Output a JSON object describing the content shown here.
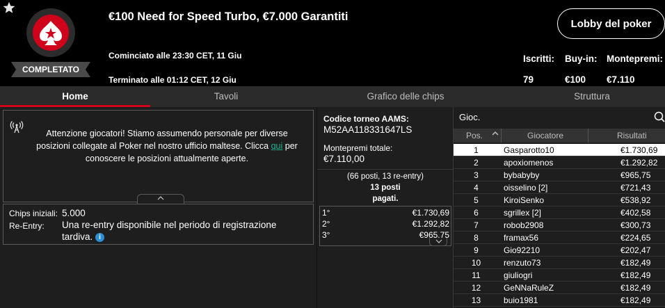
{
  "header": {
    "title": "€100 Need for Speed Turbo, €7.000 Garantiti",
    "started": "Cominciato alle 23:30 CET, 11 Giu",
    "ended": "Terminato alle 01:12 CET, 12 Giu",
    "status": "COMPLETATO",
    "lobby_button": "Lobby del poker",
    "stats": {
      "entrants_label": "Iscritti:",
      "entrants_value": "79",
      "buyin_label": "Buy-in:",
      "buyin_value": "€100",
      "prizepool_label": "Montepremi:",
      "prizepool_value": "€7.110"
    }
  },
  "tabs": [
    {
      "label": "Home",
      "active": true
    },
    {
      "label": "Tavoli",
      "active": false
    },
    {
      "label": "Grafico delle chips",
      "active": false
    },
    {
      "label": "Struttura",
      "active": false
    }
  ],
  "notice": {
    "text_before": "Attenzione giocatori! Stiamo assumendo personale per diverse posizioni collegate al Poker nel nostro ufficio maltese. Clicca ",
    "link": "qui",
    "text_after": " per conoscere le posizioni attualmente aperte."
  },
  "info": {
    "chips_label": "Chips iniziali:",
    "chips_value": "5.000",
    "reentry_label": "Re-Entry:",
    "reentry_value": "Una re-entry disponibile nel periodo di registrazione tardiva."
  },
  "middle": {
    "code_label": "Codice torneo AAMS:",
    "code_value": "M52AA118331647LS",
    "prizepool_label": "Montepremi totale:",
    "prizepool_value": "€7.110,00",
    "seats_line1": "(66 posti, 13 re-entry)",
    "seats_line2": "13 posti",
    "seats_line3": "pagati.",
    "prizes": [
      {
        "pos": "1°",
        "amount": "€1.730,69"
      },
      {
        "pos": "2°",
        "amount": "€1.292,82"
      },
      {
        "pos": "3°",
        "amount": "€965,75"
      }
    ]
  },
  "results": {
    "search_placeholder": "Gioc.",
    "col_pos": "Pos.",
    "col_player": "Giocatore",
    "col_results": "Risultati",
    "rows": [
      {
        "pos": "1",
        "name": "Gasparotto10",
        "result": "€1.730,69"
      },
      {
        "pos": "2",
        "name": "apoxiomenos",
        "result": "€1.292,82"
      },
      {
        "pos": "3",
        "name": "bybabyby",
        "result": "€965,75"
      },
      {
        "pos": "4",
        "name": "oisselino [2]",
        "result": "€721,43"
      },
      {
        "pos": "5",
        "name": "KiroiSenko",
        "result": "€538,92"
      },
      {
        "pos": "6",
        "name": "sgrillex [2]",
        "result": "€402,58"
      },
      {
        "pos": "7",
        "name": "robob2908",
        "result": "€300,73"
      },
      {
        "pos": "8",
        "name": "framax56",
        "result": "€224,65"
      },
      {
        "pos": "9",
        "name": "Gio92210",
        "result": "€202,47"
      },
      {
        "pos": "10",
        "name": "renzuto73",
        "result": "€182,49"
      },
      {
        "pos": "11",
        "name": "giuliogri",
        "result": "€182,49"
      },
      {
        "pos": "12",
        "name": "GeNNaRuleZ",
        "result": "€182,49"
      },
      {
        "pos": "13",
        "name": "buio1981",
        "result": "€182,49"
      }
    ]
  },
  "colors": {
    "accent_red": "#d0021b",
    "link_green": "#19b394",
    "info_blue": "#2b8fd6"
  }
}
